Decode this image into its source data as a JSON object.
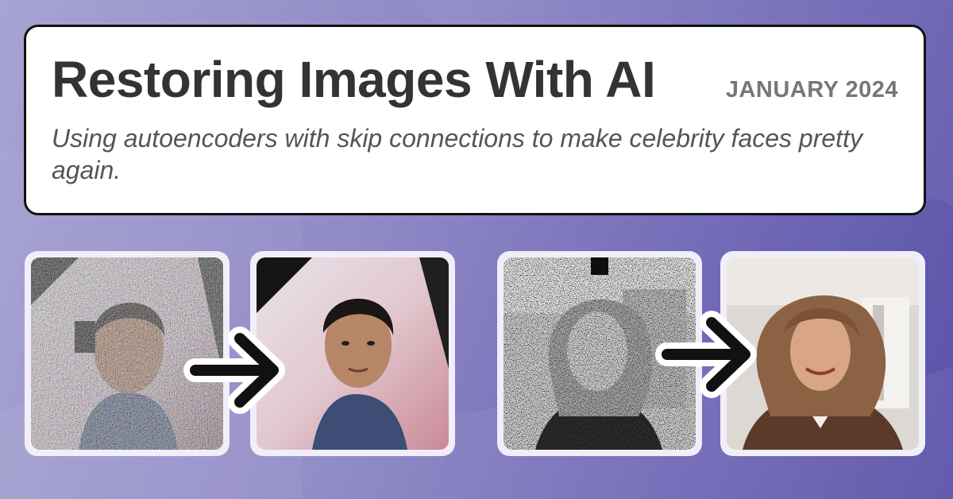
{
  "header": {
    "title": "Restoring Images With AI",
    "date": "JANUARY 2024",
    "subtitle": "Using autoencoders with skip connections to make celebrity faces pretty again."
  },
  "examples": [
    {
      "input": "noisy-color-face",
      "output": "restored-color-face"
    },
    {
      "input": "noisy-grayscale-face",
      "output": "restored-color-face"
    }
  ],
  "icons": [
    "right-arrow-icon"
  ],
  "colors": {
    "background_start": "#a7a3d2",
    "background_end": "#5a52a8",
    "card_border": "#111111",
    "tile_frame": "#f1eef9"
  }
}
